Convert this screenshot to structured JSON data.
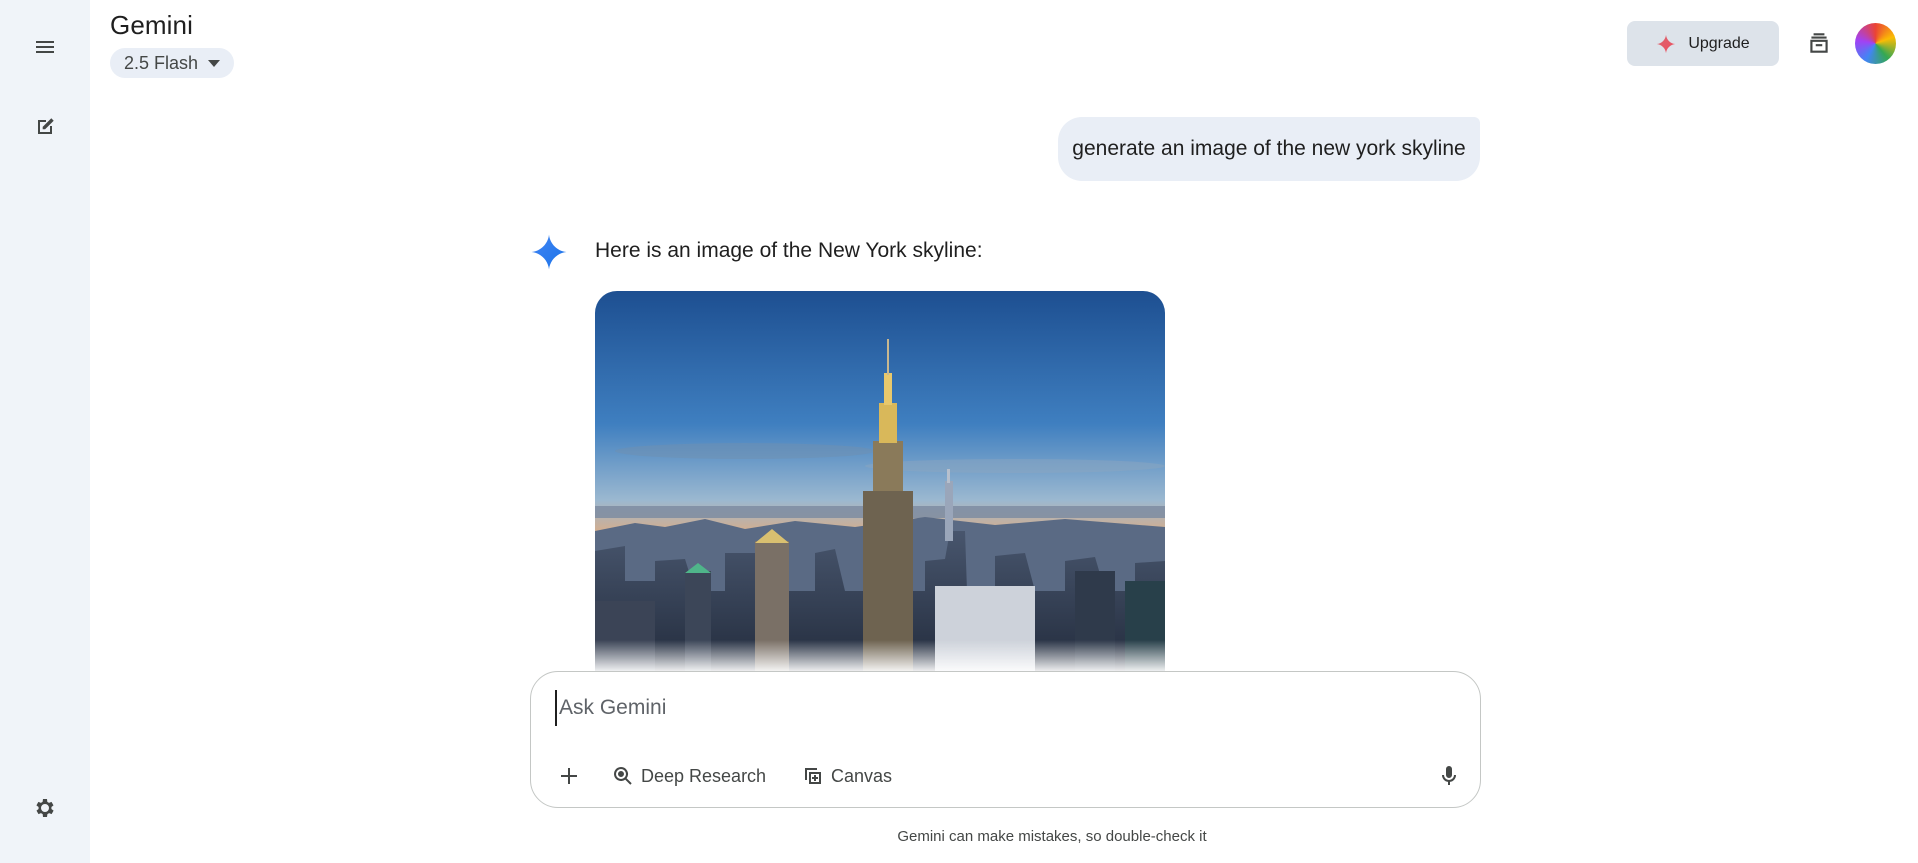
{
  "app": {
    "title": "Gemini",
    "model_selector": {
      "label": "2.5 Flash"
    }
  },
  "sidebar": {
    "menu_icon": "menu-icon",
    "new_chat_icon": "edit-icon",
    "settings_icon": "settings-icon"
  },
  "header": {
    "upgrade_label": "Upgrade",
    "upgrade_icon": "sparkle-icon",
    "stack_icon": "stack-icon"
  },
  "conversation": {
    "user_prompt": "generate an image of the new york skyline",
    "response_text": "Here is an image of the New York skyline:",
    "generated_image": "new-york-skyline-image"
  },
  "composer": {
    "placeholder": "Ask Gemini",
    "value": "",
    "tools": [
      {
        "label": "Deep Research",
        "icon": "deep-research-icon"
      },
      {
        "label": "Canvas",
        "icon": "canvas-icon"
      }
    ],
    "mic_icon": "mic-icon",
    "add_icon": "plus-icon"
  },
  "footer": {
    "disclaimer": "Gemini can make mistakes, so double-check it"
  },
  "colors": {
    "sidebar_bg": "#f0f4f9",
    "bubble_bg": "#e9eef6",
    "upgrade_bg": "#dde3ea",
    "spark_blue": "#4285f4"
  }
}
